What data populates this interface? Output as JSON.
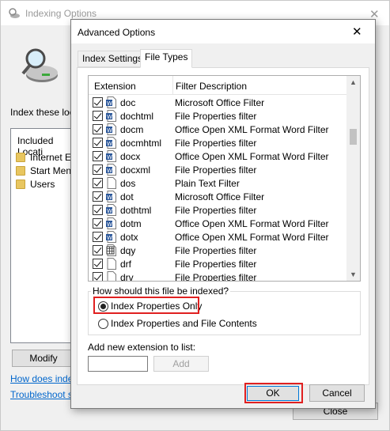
{
  "background_window": {
    "title": "Indexing Options",
    "index_label": "Index these loca",
    "list_header": "Included Locati",
    "locations": [
      "Internet Ex",
      "Start Menu",
      "Users"
    ],
    "modify_label": "Modify",
    "link_how": "How does index",
    "link_troubleshoot": "Troubleshoot se",
    "close_label": "Close"
  },
  "dialog": {
    "title": "Advanced Options",
    "close_glyph": "✕",
    "tabs": [
      {
        "label": "Index Settings",
        "active": false
      },
      {
        "label": "File Types",
        "active": true
      }
    ],
    "columns": {
      "extension": "Extension",
      "filter": "Filter Description"
    },
    "rows": [
      {
        "ext": "doc",
        "filter": "Microsoft Office Filter",
        "checked": true,
        "icon": "word-doc-icon"
      },
      {
        "ext": "dochtml",
        "filter": "File Properties filter",
        "checked": true,
        "icon": "word-doc-icon"
      },
      {
        "ext": "docm",
        "filter": "Office Open XML Format Word Filter",
        "checked": true,
        "icon": "word-doc-icon"
      },
      {
        "ext": "docmhtml",
        "filter": "File Properties filter",
        "checked": true,
        "icon": "word-doc-icon"
      },
      {
        "ext": "docx",
        "filter": "Office Open XML Format Word Filter",
        "checked": true,
        "icon": "word-doc-icon"
      },
      {
        "ext": "docxml",
        "filter": "File Properties filter",
        "checked": true,
        "icon": "word-doc-icon"
      },
      {
        "ext": "dos",
        "filter": "Plain Text Filter",
        "checked": true,
        "icon": "blank-file-icon"
      },
      {
        "ext": "dot",
        "filter": "Microsoft Office Filter",
        "checked": true,
        "icon": "word-doc-icon"
      },
      {
        "ext": "dothtml",
        "filter": "File Properties filter",
        "checked": true,
        "icon": "word-doc-icon"
      },
      {
        "ext": "dotm",
        "filter": "Office Open XML Format Word Filter",
        "checked": true,
        "icon": "word-doc-icon"
      },
      {
        "ext": "dotx",
        "filter": "Office Open XML Format Word Filter",
        "checked": true,
        "icon": "word-doc-icon"
      },
      {
        "ext": "dqy",
        "filter": "File Properties filter",
        "checked": true,
        "icon": "query-file-icon"
      },
      {
        "ext": "drf",
        "filter": "File Properties filter",
        "checked": true,
        "icon": "blank-file-icon"
      },
      {
        "ext": "drv",
        "filter": "File Properties filter",
        "checked": true,
        "icon": "blank-file-icon"
      }
    ],
    "index_question": "How should this file be indexed?",
    "option_properties_only": "Index Properties Only",
    "option_properties_and_contents": "Index Properties and File Contents",
    "selected_option": "properties_only",
    "add_extension_label": "Add new extension to list:",
    "add_extension_value": "",
    "add_button": "Add",
    "ok_button": "OK",
    "cancel_button": "Cancel"
  },
  "colors": {
    "highlight": "#e02020",
    "word_icon": "#2b579a",
    "link": "#0066cc",
    "focus_border": "#0078d7"
  }
}
